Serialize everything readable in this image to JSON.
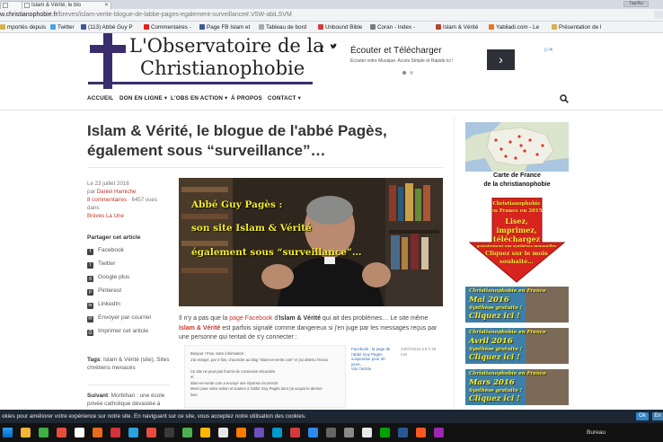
{
  "browser": {
    "tabs": [
      {
        "label": ""
      },
      {
        "label": "Islam & Vérité, le blo"
      }
    ],
    "window_button": "Tap/Aa",
    "url_main": "w.christianophobie.fr",
    "url_rest": "/breves/islam-verite-blogue-de-labbe-pages-egalement-surveillance#.V5W-abiLSVM",
    "bookmarks": [
      {
        "label": "mportés depuis",
        "icon": "folder-icon",
        "color": "#d8b24a"
      },
      {
        "label": "Twitter",
        "icon": "twitter-icon",
        "color": "#4aa3e8"
      },
      {
        "label": "(113) Abbé Guy P",
        "icon": "facebook-icon",
        "color": "#3b5998"
      },
      {
        "label": "Commentaires -",
        "icon": "youtube-icon",
        "color": "#e62117"
      },
      {
        "label": "Page FB Islam et",
        "icon": "facebook-icon",
        "color": "#3b5998"
      },
      {
        "label": "Tableau de bord",
        "icon": "page-icon",
        "color": "#aaaaaa"
      },
      {
        "label": "Unbound Bible",
        "icon": "bible-icon",
        "color": "#d23b3b"
      },
      {
        "label": "Coran - Index -",
        "icon": "quran-icon",
        "color": "#7a7a7a"
      },
      {
        "label": "Islam & Vérité",
        "icon": "cross-icon",
        "color": "#b5472f"
      },
      {
        "label": "Yabiladi.com - Le",
        "icon": "yabiladi-icon",
        "color": "#e87722"
      },
      {
        "label": "Présentation de l",
        "icon": "folder-icon",
        "color": "#d8b24a"
      }
    ]
  },
  "site": {
    "logo_line1": "L'Observatoire de la",
    "logo_line2": "Christianophobie",
    "social_fb": "f",
    "social_tw": "🐦",
    "ad": {
      "title": "Écouter et Télécharger",
      "subtitle": "Écouter votre Musique. Accès Simple et Rapide ici !",
      "arrow": "›",
      "close": "▷✕"
    },
    "nav": [
      "ACCUEIL",
      "DON EN LIGNE ▾",
      "L'OBS EN ACTION ▾",
      "À PROPOS",
      "CONTACT ▾"
    ]
  },
  "article": {
    "title": "Islam & Vérité, le blogue de l'abbé Pagès, également sous “surveillance”…",
    "date": "Le 23 juillet 2016",
    "by": "par",
    "author": "Daniel Hamiche",
    "comments": "8 commentaires",
    "views": " · 6457 vues dans",
    "category": "Brèves La Une",
    "share_heading": "Partager cet article",
    "share": [
      {
        "label": "Facebook",
        "icon": "facebook-icon"
      },
      {
        "label": "Twitter",
        "icon": "twitter-icon"
      },
      {
        "label": "Google plus",
        "icon": "google-plus-icon"
      },
      {
        "label": "Pinterest",
        "icon": "pinterest-icon"
      },
      {
        "label": "LinkedIn",
        "icon": "linkedin-icon"
      },
      {
        "label": "Envoyer par courriel",
        "icon": "email-icon"
      },
      {
        "label": "Imprimer cet article",
        "icon": "print-icon"
      }
    ],
    "tags_label": "Tags",
    "tags_text": ": Islam & Vérité (site), Sites chrétiens menacés",
    "suivant_label": "Suivant",
    "suivant_text": ": Morbihan : une école privée catholique dévastée à",
    "video_lines": [
      "Abbé Guy Pagès :",
      "son site Islam & Vérité",
      "également sous “surveillance”…"
    ],
    "para_1": "Il n'y a pas que la ",
    "para_link": "page Facebook",
    "para_2": " d'",
    "para_bold1": "Islam & Vérité",
    "para_3": " qui ait des problèmes… Le site même ",
    "para_bold2": "Islam & Vérité",
    "para_4": " est parfois signalé comme dangereux si j'en juge par les messages reçus par une personne qui tentait de s'y connecter :",
    "embed": {
      "lines": [
        "Bonjour ! Pour votre information :",
        "J'ai essayé, par 3 fois, d'accéder au blog \"islam-et-verite.com\" et j'ai obtenu l'écran",
        "",
        "Ce site ne peut pas fournir de connexion sécurisée",
        "et",
        "islam-et-verite.com a envoyé une réponse incorrecte",
        "Merci pour votre action et soutien à l'abbé Guy Pagès dont j'ai acquis le dernier",
        "livre"
      ],
      "link": "Facebook : la page de l'abbé Guy Pagès suspendue pour 30 jours…",
      "link_more": "Voir l'article",
      "date": "23/07/2016 à 8 h 39 min"
    }
  },
  "sidebar": {
    "map_caption_1": "Carte de France",
    "map_caption_2": "de la christianophobie",
    "arrow_lines": [
      "Christianophobie",
      "en France en 2015",
      "Lisez,",
      "imprimez,",
      "téléchargez",
      "gratuitement nos synthèses mensuelles",
      "Cliquez sur le mois",
      "souhaité…"
    ],
    "banners": [
      {
        "title": "Christianophobie en France",
        "month": "Mai 2016",
        "sub": "Synthèse gratuite !",
        "cta": "Cliquez ici !"
      },
      {
        "title": "Christianophobie en France",
        "month": "Avril 2016",
        "sub": "Synthèse gratuite !",
        "cta": "Cliquez ici !"
      },
      {
        "title": "Christianophobie en France",
        "month": "Mars 2016",
        "sub": "Synthèse gratuite !",
        "cta": "Cliquez ici !"
      }
    ]
  },
  "cookie": {
    "text": "okies pour améliorer votre expérience sur notre site. En naviguant sur ce site, vous acceptez notre utilisation des cookies.",
    "ok": "Ok",
    "more": "En"
  },
  "taskbar": {
    "right": "Bureau"
  }
}
